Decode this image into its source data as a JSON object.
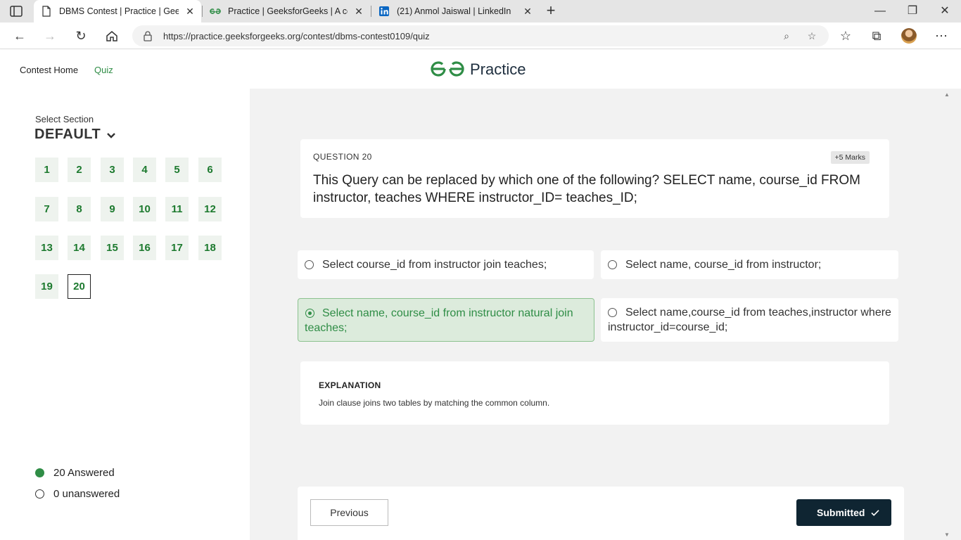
{
  "browser": {
    "tabs": [
      {
        "title": "DBMS Contest | Practice | GeeksforGeeks",
        "active": true
      },
      {
        "title": "Practice | GeeksforGeeks | A computer science portal for geeks",
        "active": false
      },
      {
        "title": "(21) Anmol Jaiswal | LinkedIn",
        "active": false
      }
    ],
    "url": "https://practice.geeksforgeeks.org/contest/dbms-contest0109/quiz"
  },
  "header": {
    "nav": [
      "Contest Home",
      "Quiz"
    ],
    "logo_text": "Practice",
    "brand_color": "#2f8d46"
  },
  "sidebar": {
    "select_label": "Select Section",
    "section": "DEFAULT",
    "questions": [
      "1",
      "2",
      "3",
      "4",
      "5",
      "6",
      "7",
      "8",
      "9",
      "10",
      "11",
      "12",
      "13",
      "14",
      "15",
      "16",
      "17",
      "18",
      "19",
      "20"
    ],
    "current_question": "20",
    "answered_label": "20 Answered",
    "unanswered_label": "0 unanswered"
  },
  "question": {
    "number_label": "QUESTION 20",
    "marks": "+5 Marks",
    "text": "This Query can be replaced by which one of the following? SELECT name, course_id FROM instructor, teaches WHERE instructor_ID= teaches_ID;"
  },
  "options": [
    {
      "text": "Select course_id from instructor join teaches;",
      "selected": false
    },
    {
      "text": "Select name, course_id from instructor;",
      "selected": false
    },
    {
      "text": "Select name, course_id from instructor natural join teaches;",
      "selected": true
    },
    {
      "text": "Select name,course_id from teaches,instructor where instructor_id=course_id;",
      "selected": false
    }
  ],
  "explanation": {
    "title": "EXPLANATION",
    "text": "Join clause joins two tables by matching the common column."
  },
  "footer": {
    "previous_label": "Previous",
    "submitted_label": "Submitted"
  }
}
